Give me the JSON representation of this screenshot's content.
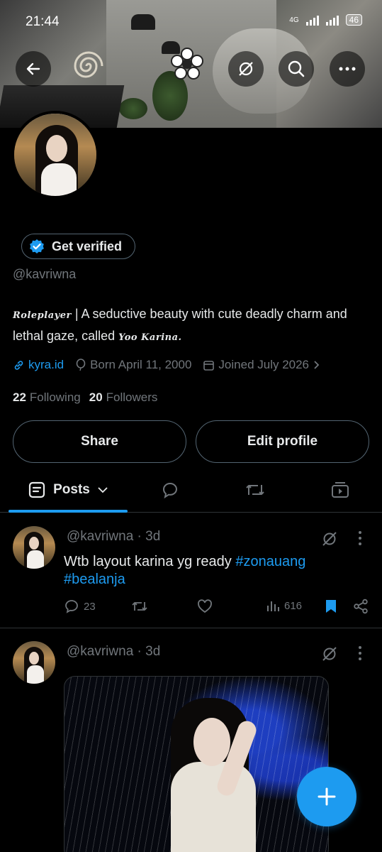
{
  "status_bar": {
    "time": "21:44",
    "network": "4G",
    "battery": "46"
  },
  "profile": {
    "verify_label": "Get verified",
    "handle": "@kavriwna",
    "bio_prefix": "Roleplayer",
    "bio_main": " | A seductive beauty with cute deadly charm and lethal gaze, called ",
    "bio_suffix": "Yoo Karina.",
    "website": "kyra.id",
    "born": "Born April 11, 2000",
    "joined": "Joined July 2026",
    "following_count": "22",
    "following_label": "Following",
    "followers_count": "20",
    "followers_label": "Followers"
  },
  "buttons": {
    "share": "Share",
    "edit_profile": "Edit profile"
  },
  "tabs": {
    "posts": "Posts"
  },
  "posts": [
    {
      "handle_time": "@kavriwna · 3d",
      "text": "Wtb layout karina yg ready ",
      "hashtag1": "#zonauang",
      "hashtag2": "#bealanja",
      "replies": "23",
      "views": "616"
    },
    {
      "handle_time": "@kavriwna · 3d"
    }
  ],
  "colors": {
    "accent": "#1d9bf0",
    "background": "#000000",
    "muted": "#71767b"
  }
}
